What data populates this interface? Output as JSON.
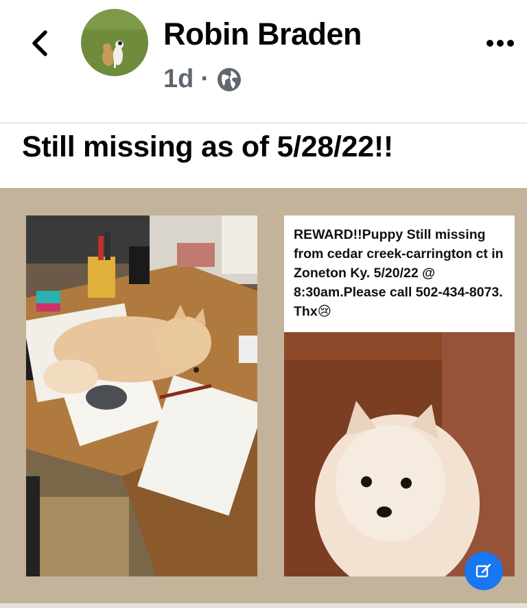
{
  "header": {
    "author_name": "Robin Braden",
    "timestamp": "1d",
    "separator": "·",
    "privacy_icon": "globe-icon",
    "back_icon": "chevron-left-icon",
    "more_icon": "more-dots-icon"
  },
  "post": {
    "text": "Still missing as of 5/28/22!!"
  },
  "media": {
    "flyer_text": "REWARD!!Puppy Still missing from cedar creek-carrington ct in Zoneton Ky.  5/20/22 @ 8:30am.Please call 502-434-8073. Thx😢",
    "edit_icon": "edit-icon"
  },
  "colors": {
    "media_background": "#c3b39a",
    "accent": "#1877f2",
    "secondary_text": "#606770"
  }
}
